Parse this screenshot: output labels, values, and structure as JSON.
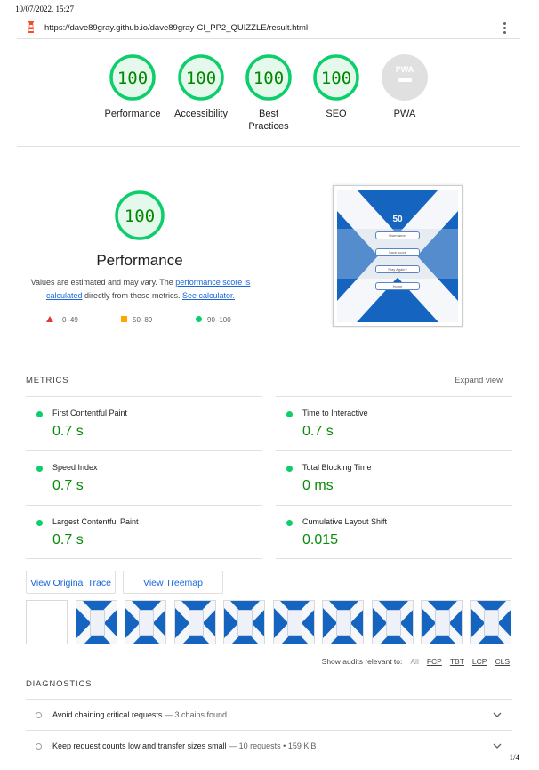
{
  "print": {
    "date": "10/07/2022, 15:27",
    "page": "1/4"
  },
  "urlbar": {
    "url": "https://dave89gray.github.io/dave89gray-CI_PP2_QUIZZLE/result.html"
  },
  "categories": [
    {
      "label": "Performance",
      "score": "100"
    },
    {
      "label": "Accessibility",
      "score": "100"
    },
    {
      "label": "Best\nPractices",
      "score": "100"
    },
    {
      "label": "SEO",
      "score": "100"
    },
    {
      "label": "PWA",
      "score": "PWA"
    }
  ],
  "hero": {
    "score": "100",
    "title": "Performance",
    "desc_prefix": "Values are estimated and may vary. The ",
    "desc_link1": "performance score is calculated",
    "desc_mid": " directly from these metrics. ",
    "desc_link2": "See calculator.",
    "legend": [
      "0–49",
      "50–89",
      "90–100"
    ]
  },
  "screenshot": {
    "score": "50",
    "buttons": [
      "Username:",
      "Save score",
      "Play Again?",
      "Home"
    ]
  },
  "metrics": {
    "heading": "METRICS",
    "expand": "Expand view",
    "items": [
      {
        "name": "First Contentful Paint",
        "value": "0.7 s"
      },
      {
        "name": "Time to Interactive",
        "value": "0.7 s"
      },
      {
        "name": "Speed Index",
        "value": "0.7 s"
      },
      {
        "name": "Total Blocking Time",
        "value": "0 ms"
      },
      {
        "name": "Largest Contentful Paint",
        "value": "0.7 s"
      },
      {
        "name": "Cumulative Layout Shift",
        "value": "0.015"
      }
    ]
  },
  "buttons": {
    "trace": "View Original Trace",
    "treemap": "View Treemap"
  },
  "filter": {
    "label": "Show audits relevant to:",
    "options": [
      "All",
      "FCP",
      "TBT",
      "LCP",
      "CLS"
    ]
  },
  "diagnostics": {
    "heading": "DIAGNOSTICS",
    "items": [
      {
        "title": "Avoid chaining critical requests",
        "detail": "3 chains found"
      },
      {
        "title": "Keep request counts low and transfer sizes small",
        "detail": "10 requests • 159 KiB"
      }
    ]
  },
  "colors": {
    "pass": "#0cce6b",
    "pass_text": "#008800",
    "link": "#1a66d9",
    "flag": "#1565c0"
  }
}
